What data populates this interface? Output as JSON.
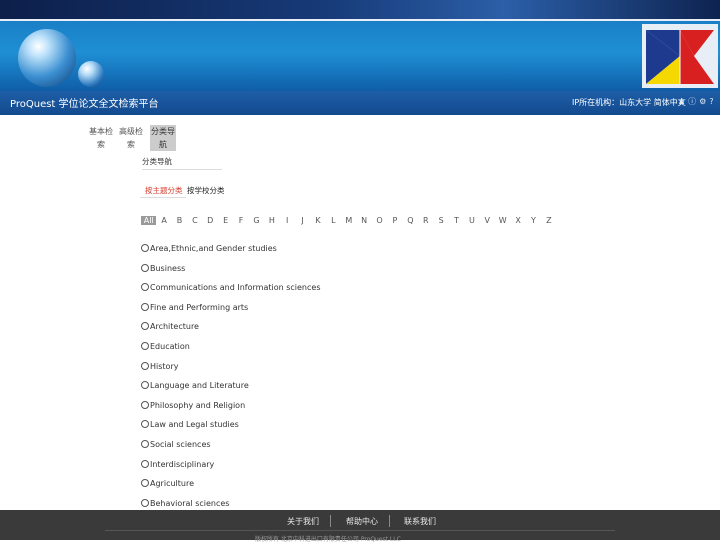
{
  "header": {
    "brand": "ProQuest 学位论文全文检索平台",
    "user_info": "IP所在机构：山东大学",
    "language": "简体中文",
    "icon_names": [
      "user-icon",
      "info-icon",
      "settings-icon",
      "help-icon"
    ]
  },
  "left_tabs": [
    {
      "line1": "基本检",
      "line2": "索",
      "active": false
    },
    {
      "line1": "高级检",
      "line2": "索",
      "active": false
    },
    {
      "line1": "分类导",
      "line2": "航",
      "active": true
    }
  ],
  "breadcrumb": "分类导航",
  "subtabs": [
    {
      "label": "按主题分类",
      "active": true
    },
    {
      "label": "按学校分类",
      "active": false
    }
  ],
  "letters": [
    "All",
    "A",
    "B",
    "C",
    "D",
    "E",
    "F",
    "G",
    "H",
    "I",
    "J",
    "K",
    "L",
    "M",
    "N",
    "O",
    "P",
    "Q",
    "R",
    "S",
    "T",
    "U",
    "V",
    "W",
    "X",
    "Y",
    "Z"
  ],
  "selected_letter": "All",
  "categories": [
    "Area,Ethnic,and Gender studies",
    "Business",
    "Communications and Information sciences",
    "Fine and Performing arts",
    "Architecture",
    "Education",
    "History",
    "Language and Literature",
    "Philosophy and Religion",
    "Law and Legal studies",
    "Social sciences",
    "Interdisciplinary",
    "Agriculture",
    "Behavioral sciences"
  ],
  "footer": {
    "links": [
      "关于我们",
      "帮助中心",
      "联系我们"
    ],
    "copyright": "版权所有 北京中科进出口有限责任公司 ProQuest LLC"
  },
  "colors": {
    "accent_red": "#d63b2a",
    "nav_blue": "#134a8e"
  }
}
